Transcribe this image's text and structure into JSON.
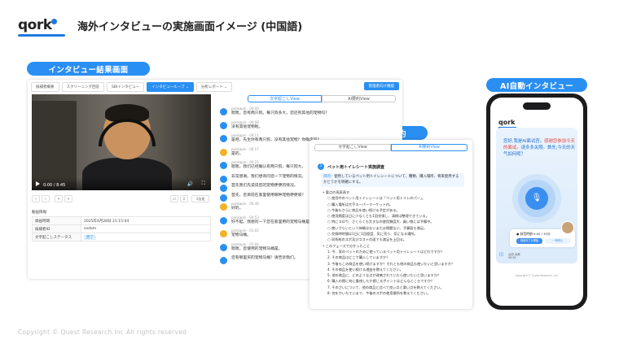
{
  "header": {
    "logo_text": "qork",
    "title": "海外インタビューの実施画面イメージ (中国語)"
  },
  "labels": {
    "interview_results": "インタビュー結果画面",
    "ai_translation": "AIによる翻訳と要約",
    "ai_interview": "AI自動インタビュー"
  },
  "interview_panel": {
    "tabs": [
      "候補者概要",
      "スクリーニング回答",
      "SBIインタビュー",
      "インタビューループ ⌄",
      "分析レポート ⌄"
    ],
    "admin_button": "管理者向け機能",
    "video": {
      "time": "0:00 / 8:45"
    },
    "speed_label": "1倍速",
    "info_title": "動画情報",
    "info_rows": [
      {
        "key": "録画時間",
        "value": "2025年4月28日 21:15:04"
      },
      {
        "key": "候補者ID",
        "value": "sodam"
      },
      {
        "key": "文字起こしステータス",
        "value": "完了"
      }
    ],
    "view_tabs": [
      "文字起こしView",
      "AI要約View"
    ],
    "messages": [
      {
        "role": "q",
        "who": "ponkapin · 00:00",
        "text": "嗯嗯。您有两只狗。每只狗多大，您还有其他的宠物吗？"
      },
      {
        "role": "q",
        "who": "ponkapin · 00:08",
        "text": "没有其他宠物啦。"
      },
      {
        "role": "q",
        "who": "ponkapin · 00:11",
        "text": "是吧。先生你有两只狗，没有其他宠物？你确定吗？"
      },
      {
        "role": "a",
        "who": "ponkapin · 00:17",
        "text": "是的。"
      },
      {
        "role": "q",
        "who": "ponkapin · 00:21",
        "text": "嗯嗯。我们已经确认有两只狗，每只狗大。"
      },
      {
        "role": "q",
        "who": "",
        "text": "非常感谢。我们想询问您一下宠物的情况。"
      },
      {
        "role": "q",
        "who": "",
        "text": "首先我们先说说您的宠物便便的情况。"
      },
      {
        "role": "q",
        "who": "",
        "text": "首先，您目前在家里使用哪种宠物便便袋？"
      },
      {
        "role": "a",
        "who": "ponkapin · 00:48",
        "text": "好的。"
      },
      {
        "role": "q",
        "who": "ponkapin · 00:53",
        "text": "好不起。我想问一下您在家里用的宠物马桶是…"
      },
      {
        "role": "a",
        "who": "ponkapin · 01:02",
        "text": "宠物马桶。"
      },
      {
        "role": "q",
        "who": "ponkapin · 01:04",
        "text": "嗯嗯。您使用的宠物马桶是。"
      },
      {
        "role": "q",
        "who": "",
        "text": "您有哪里买的宠物马桶？请告诉我们。"
      }
    ]
  },
  "translation_panel": {
    "tabs": [
      "文字起こしView",
      "AI要約View"
    ],
    "section_number": "1",
    "section_title": "ペット用トイレシート実施調査",
    "purpose_label": "目的：",
    "purpose_text": "使用しているペット用トイレシートについて、種類、購入場所、将来使用するかどうかを明確にする。",
    "lines": [
      {
        "level": 0,
        "text": "• 要点の再表表す"
      },
      {
        "level": 1,
        "text": "○ 使用中のペット用トイレシートは「ペット用トイレのパー」。"
      },
      {
        "level": 1,
        "text": "○ 購入場所は大手スーパーマーケット内。"
      },
      {
        "level": 1,
        "text": "○ 今後もさらに商品を使い続ける予定がある。"
      },
      {
        "level": 1,
        "text": "○ 使用頻度は日に少なくとも1回交換し、清掃は整理できている。"
      },
      {
        "level": 1,
        "text": "○ 特にコロウ、さくらくも大きなの使用頻度大、買い物には予備中。"
      },
      {
        "level": 1,
        "text": "○ 使いづらいという体験はないまたは問題ない、予算面も満足。"
      },
      {
        "level": 1,
        "text": "○ 交換時時間は1日に1回程度、気に売り、気になる場所。"
      },
      {
        "level": 1,
        "text": "○ 同系統のスポ及びコストの面でも満足を上回る。"
      },
      {
        "level": 0,
        "text": "• このフェーズで分かったこと"
      },
      {
        "level": 1,
        "text": "1. 今、家のペットのために使っているペット用トイレシートはどれですか？"
      },
      {
        "level": 1,
        "text": "2. その商品はどこで購入していますか？"
      },
      {
        "level": 1,
        "text": "3. 今後もこの商品を使い続けますか？それとも他の商品も使いたいと思いますか？"
      },
      {
        "level": 1,
        "text": "4. その商品を使い続ける理由を教えてください。"
      },
      {
        "level": 1,
        "text": "5. 他の商品に、どのような点が改善されていたら使いたいと思いますか？"
      },
      {
        "level": 1,
        "text": "6. 購入の際に何に重視したか感じるポイントはどんなところですか？"
      },
      {
        "level": 1,
        "text": "7. そのさいについて、他の商品と比べて良い点と悪い点を教えてください。"
      },
      {
        "level": 1,
        "text": "8. 何をかいたていまで、今後のスポの使用場所を教えてください。"
      }
    ]
  },
  "phone": {
    "logo_text": "qork",
    "greeting_parts": [
      {
        "text": "您好,我是AI面试官。",
        "hl": false
      },
      {
        "text": "感谢您参加今天的面试。",
        "hl": true
      },
      {
        "text": "请多多关照。首先,今天的天气如何呢？",
        "hl": false
      }
    ],
    "record_title": "● 録音時間 0:00 / 30分",
    "button_primary": "録音完了を開始",
    "button_secondary": "一時停止",
    "bottom_text": "山田 太郎\n00:01",
    "copyright": "Copyright © Quest Research, Inc."
  },
  "footer": {
    "copyright": "Copyright © Quest Research.Inc All rights reserved"
  },
  "colors": {
    "accent": "#2a8ff2",
    "brand": "#1f7ae0"
  }
}
